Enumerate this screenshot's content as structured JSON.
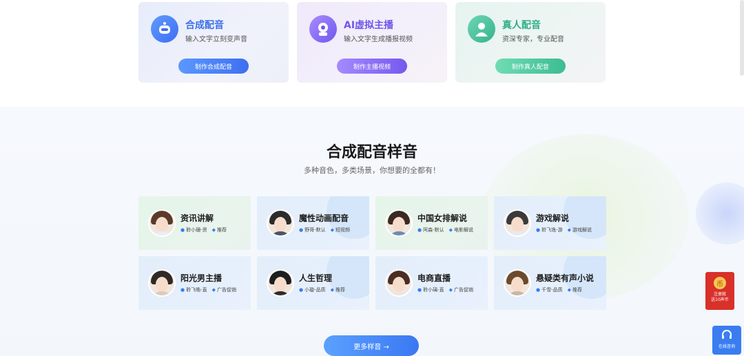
{
  "product_cards": [
    {
      "title": "合成配音",
      "desc": "输入文字立刻变声音",
      "button": "制作合成配音",
      "icon": "robot-icon"
    },
    {
      "title": "AI虚拟主播",
      "desc": "输入文字生成播报视频",
      "button": "制作主播视频",
      "icon": "virtual-anchor-icon"
    },
    {
      "title": "真人配音",
      "desc": "资深专家，专业配音",
      "button": "制作真人配音",
      "icon": "voice-actor-icon"
    }
  ],
  "section": {
    "title": "合成配音样音",
    "subtitle": "多种音色，多类场景，你想要的全都有！",
    "more_button": "更多样音 →"
  },
  "voices": [
    {
      "name": "资讯讲解",
      "voice": "聆小珊-资",
      "tag": "推荐"
    },
    {
      "name": "魔性动画配音",
      "voice": "野哥-默认",
      "tag": "短视频"
    },
    {
      "name": "中国女排解说",
      "voice": "阿森-默认",
      "tag": "电影解说"
    },
    {
      "name": "游戏解说",
      "voice": "聆飞逸-游",
      "tag": "游戏解说"
    },
    {
      "name": "阳光男主播",
      "voice": "聆飞皓-直",
      "tag": "广告促销"
    },
    {
      "name": "人生哲理",
      "voice": "小璇-品质",
      "tag": "推荐"
    },
    {
      "name": "电商直播",
      "voice": "聆小璃-直",
      "tag": "广告促销"
    },
    {
      "name": "悬疑类有声小说",
      "voice": "千雪-品质",
      "tag": "推荐"
    }
  ],
  "float": {
    "redpack_coin": "币",
    "redpack_line1": "注册就",
    "redpack_line2": "送10声币",
    "support_label": "在线咨询"
  }
}
